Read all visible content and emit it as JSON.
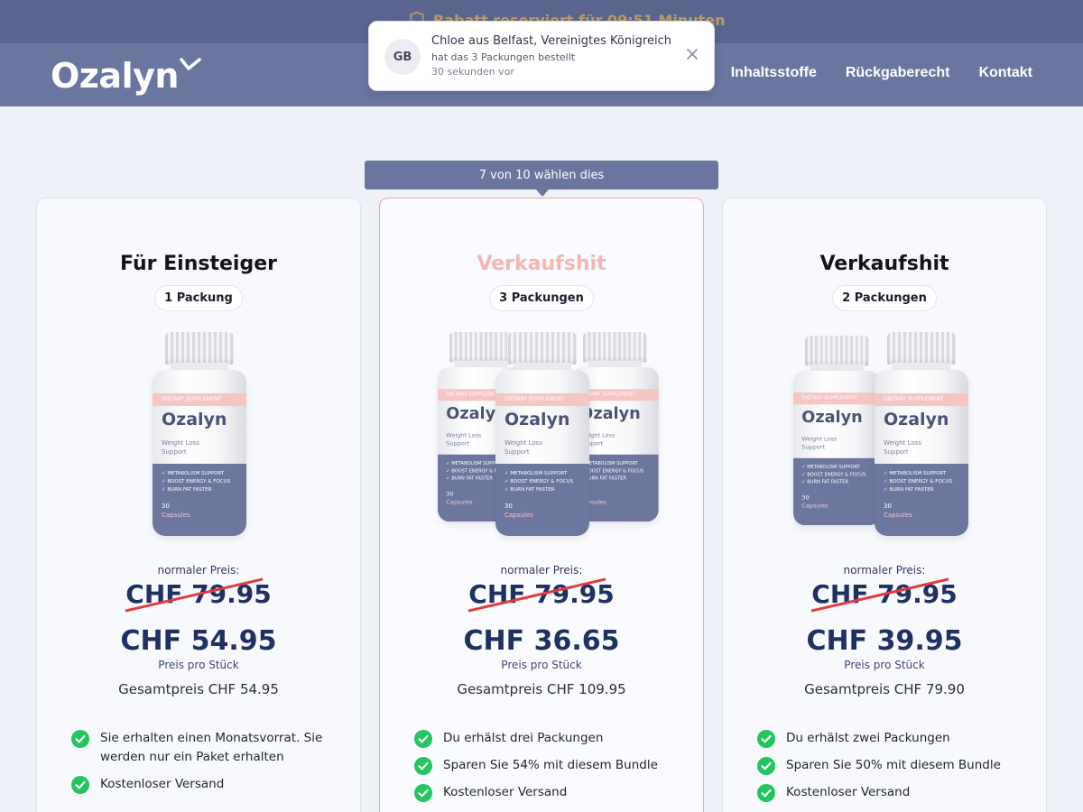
{
  "topbar": {
    "timer_text": "Rabatt reserviert für 09:51 Minuten"
  },
  "header": {
    "logo": "Ozalyn",
    "nav": [
      "Inhaltsstoffe",
      "Rückgaberecht",
      "Kontakt"
    ]
  },
  "toast": {
    "avatar": "GB",
    "line1": "Chloe aus Belfast, Vereinigtes Königreich",
    "line2": "hat das 3 Packungen bestellt",
    "line3": "30 sekunden vor"
  },
  "ribbon": "7 von 10 wählen dies",
  "bottle": {
    "band": "DIETARY SUPPLEMENT",
    "brand": "Ozalyn",
    "sub1": "Weight Loss",
    "sub2": "Support",
    "b1": "✓ METABOLISM SUPPORT",
    "b2": "✓ BOOST ENERGY & FOCUS",
    "b3": "✓ BURN FAT FASTER",
    "count": "30",
    "capsules": "Capsules"
  },
  "cards": [
    {
      "title": "Für Einsteiger",
      "pill": "1 Packung",
      "regular_label": "normaler Preis:",
      "old_price": "CHF 79.95",
      "price": "CHF 54.95",
      "unit": "Preis pro Stück",
      "total": "Gesamtpreis CHF 54.95",
      "features": [
        "Sie erhalten einen Monatsvorrat. Sie werden nur ein Paket erhalten",
        "Kostenloser Versand"
      ]
    },
    {
      "title": "Verkaufshit",
      "pill": "3 Packungen",
      "regular_label": "normaler Preis:",
      "old_price": "CHF 79.95",
      "price": "CHF 36.65",
      "unit": "Preis pro Stück",
      "total": "Gesamtpreis CHF 109.95",
      "features": [
        "Du erhälst drei Packungen",
        "Sparen Sie 54% mit diesem Bundle",
        "Kostenloser Versand"
      ]
    },
    {
      "title": "Verkaufshit",
      "pill": "2 Packungen",
      "regular_label": "normaler Preis:",
      "old_price": "CHF 79.95",
      "price": "CHF 39.95",
      "unit": "Preis pro Stück",
      "total": "Gesamtpreis CHF 79.90",
      "features": [
        "Du erhälst zwei Packungen",
        "Sparen Sie 50% mit diesem Bundle",
        "Kostenloser Versand"
      ]
    }
  ],
  "colors": {
    "header": "#6a769f",
    "featured_title": "#f5b5b3",
    "price": "#1f3162",
    "check": "#22c55e",
    "strike": "#e23a3d"
  }
}
